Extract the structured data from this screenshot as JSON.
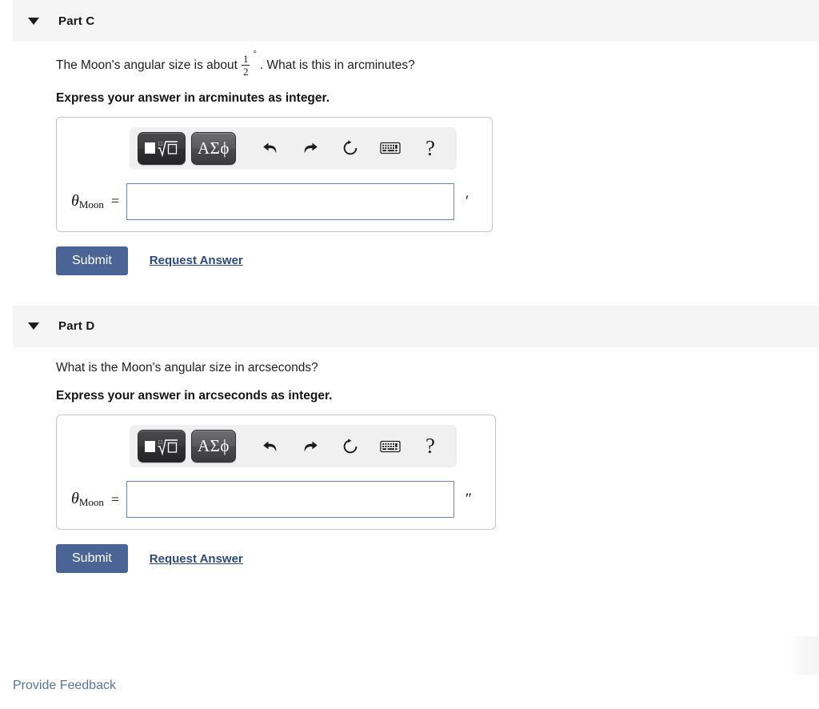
{
  "parts": [
    {
      "id": "part-c",
      "title": "Part C",
      "collapse_icon": "triangle-down-icon",
      "question_prefix": "The Moon's angular size is about",
      "fraction": {
        "numerator": "1",
        "denominator": "2",
        "unit_symbol": "°"
      },
      "question_suffix": ". What is this in arcminutes?",
      "instruction": "Express your answer in arcminutes as integer.",
      "answer": {
        "variable": "θ",
        "subscript": "Moon",
        "equals": "=",
        "value": "",
        "placeholder": "",
        "unit": "′"
      },
      "toolbar": {
        "template_button": {
          "name": "math-template-button",
          "glyph": "square-and-nth-root"
        },
        "greek_button": {
          "name": "greek-letters-button",
          "label": "ΑΣϕ"
        },
        "icons": [
          {
            "name": "undo-icon",
            "title": "undo"
          },
          {
            "name": "redo-icon",
            "title": "redo"
          },
          {
            "name": "reset-icon",
            "title": "reset"
          },
          {
            "name": "keyboard-icon",
            "title": "keyboard shortcuts"
          },
          {
            "name": "help-icon",
            "title": "help",
            "label": "?"
          }
        ]
      },
      "submit_label": "Submit",
      "request_answer_label": "Request Answer"
    },
    {
      "id": "part-d",
      "title": "Part D",
      "collapse_icon": "triangle-down-icon",
      "question_prefix": "What is the Moon's angular size in arcseconds?",
      "fraction": null,
      "question_suffix": "",
      "instruction": "Express your answer in arcseconds as integer.",
      "answer": {
        "variable": "θ",
        "subscript": "Moon",
        "equals": "=",
        "value": "",
        "placeholder": "",
        "unit": "″"
      },
      "toolbar": {
        "template_button": {
          "name": "math-template-button",
          "glyph": "square-and-nth-root"
        },
        "greek_button": {
          "name": "greek-letters-button",
          "label": "ΑΣϕ"
        },
        "icons": [
          {
            "name": "undo-icon",
            "title": "undo"
          },
          {
            "name": "redo-icon",
            "title": "redo"
          },
          {
            "name": "reset-icon",
            "title": "reset"
          },
          {
            "name": "keyboard-icon",
            "title": "keyboard shortcuts"
          },
          {
            "name": "help-icon",
            "title": "help",
            "label": "?"
          }
        ]
      },
      "submit_label": "Submit",
      "request_answer_label": "Request Answer"
    }
  ],
  "footer": {
    "feedback_label": "Provide Feedback"
  },
  "colors": {
    "header_bar": "#f5f5f5",
    "submit_button": "#4a6595",
    "link": "#2d4a7c",
    "feedback_link": "#5b749e",
    "input_border": "#7189ad",
    "panel_border": "#c6c6c6"
  }
}
